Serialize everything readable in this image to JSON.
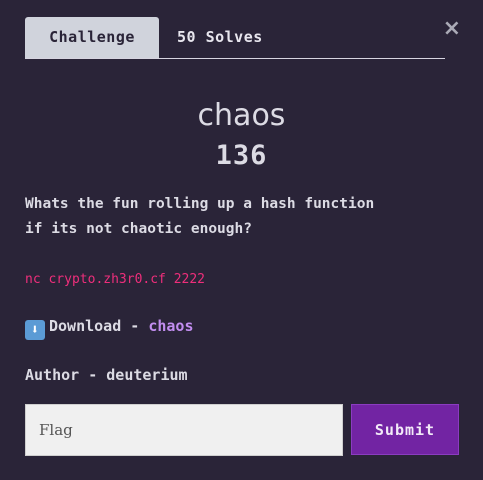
{
  "tabs": {
    "challenge": "Challenge",
    "solves": "50 Solves"
  },
  "close_icon": "×",
  "challenge": {
    "name": "chaos",
    "points": "136",
    "description_line1": "Whats the fun rolling up a hash function",
    "description_line2": "if its not chaotic enough?",
    "connection": "nc crypto.zh3r0.cf 2222",
    "download_icon": "⬇",
    "download_label": "Download - ",
    "download_file": "chaos",
    "author": "Author - deuterium"
  },
  "form": {
    "flag_placeholder": "Flag",
    "submit_label": "Submit"
  },
  "colors": {
    "background": "#2a2438",
    "active_tab": "#d0d3dc",
    "connection_text": "#ee2e7b",
    "link": "#c28ef0",
    "submit_button": "#7224a3"
  }
}
